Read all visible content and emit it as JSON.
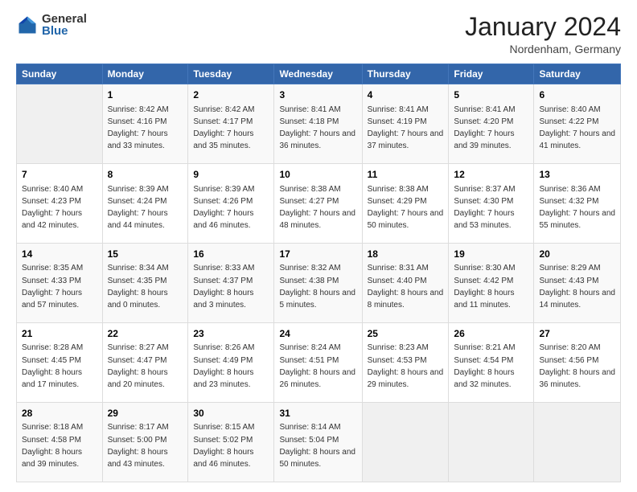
{
  "header": {
    "logo_general": "General",
    "logo_blue": "Blue",
    "month_title": "January 2024",
    "location": "Nordenham, Germany"
  },
  "days_of_week": [
    "Sunday",
    "Monday",
    "Tuesday",
    "Wednesday",
    "Thursday",
    "Friday",
    "Saturday"
  ],
  "weeks": [
    [
      {
        "day": "",
        "sunrise": "",
        "sunset": "",
        "daylight": "",
        "empty": true
      },
      {
        "day": "1",
        "sunrise": "Sunrise: 8:42 AM",
        "sunset": "Sunset: 4:16 PM",
        "daylight": "Daylight: 7 hours and 33 minutes."
      },
      {
        "day": "2",
        "sunrise": "Sunrise: 8:42 AM",
        "sunset": "Sunset: 4:17 PM",
        "daylight": "Daylight: 7 hours and 35 minutes."
      },
      {
        "day": "3",
        "sunrise": "Sunrise: 8:41 AM",
        "sunset": "Sunset: 4:18 PM",
        "daylight": "Daylight: 7 hours and 36 minutes."
      },
      {
        "day": "4",
        "sunrise": "Sunrise: 8:41 AM",
        "sunset": "Sunset: 4:19 PM",
        "daylight": "Daylight: 7 hours and 37 minutes."
      },
      {
        "day": "5",
        "sunrise": "Sunrise: 8:41 AM",
        "sunset": "Sunset: 4:20 PM",
        "daylight": "Daylight: 7 hours and 39 minutes."
      },
      {
        "day": "6",
        "sunrise": "Sunrise: 8:40 AM",
        "sunset": "Sunset: 4:22 PM",
        "daylight": "Daylight: 7 hours and 41 minutes."
      }
    ],
    [
      {
        "day": "7",
        "sunrise": "Sunrise: 8:40 AM",
        "sunset": "Sunset: 4:23 PM",
        "daylight": "Daylight: 7 hours and 42 minutes."
      },
      {
        "day": "8",
        "sunrise": "Sunrise: 8:39 AM",
        "sunset": "Sunset: 4:24 PM",
        "daylight": "Daylight: 7 hours and 44 minutes."
      },
      {
        "day": "9",
        "sunrise": "Sunrise: 8:39 AM",
        "sunset": "Sunset: 4:26 PM",
        "daylight": "Daylight: 7 hours and 46 minutes."
      },
      {
        "day": "10",
        "sunrise": "Sunrise: 8:38 AM",
        "sunset": "Sunset: 4:27 PM",
        "daylight": "Daylight: 7 hours and 48 minutes."
      },
      {
        "day": "11",
        "sunrise": "Sunrise: 8:38 AM",
        "sunset": "Sunset: 4:29 PM",
        "daylight": "Daylight: 7 hours and 50 minutes."
      },
      {
        "day": "12",
        "sunrise": "Sunrise: 8:37 AM",
        "sunset": "Sunset: 4:30 PM",
        "daylight": "Daylight: 7 hours and 53 minutes."
      },
      {
        "day": "13",
        "sunrise": "Sunrise: 8:36 AM",
        "sunset": "Sunset: 4:32 PM",
        "daylight": "Daylight: 7 hours and 55 minutes."
      }
    ],
    [
      {
        "day": "14",
        "sunrise": "Sunrise: 8:35 AM",
        "sunset": "Sunset: 4:33 PM",
        "daylight": "Daylight: 7 hours and 57 minutes."
      },
      {
        "day": "15",
        "sunrise": "Sunrise: 8:34 AM",
        "sunset": "Sunset: 4:35 PM",
        "daylight": "Daylight: 8 hours and 0 minutes."
      },
      {
        "day": "16",
        "sunrise": "Sunrise: 8:33 AM",
        "sunset": "Sunset: 4:37 PM",
        "daylight": "Daylight: 8 hours and 3 minutes."
      },
      {
        "day": "17",
        "sunrise": "Sunrise: 8:32 AM",
        "sunset": "Sunset: 4:38 PM",
        "daylight": "Daylight: 8 hours and 5 minutes."
      },
      {
        "day": "18",
        "sunrise": "Sunrise: 8:31 AM",
        "sunset": "Sunset: 4:40 PM",
        "daylight": "Daylight: 8 hours and 8 minutes."
      },
      {
        "day": "19",
        "sunrise": "Sunrise: 8:30 AM",
        "sunset": "Sunset: 4:42 PM",
        "daylight": "Daylight: 8 hours and 11 minutes."
      },
      {
        "day": "20",
        "sunrise": "Sunrise: 8:29 AM",
        "sunset": "Sunset: 4:43 PM",
        "daylight": "Daylight: 8 hours and 14 minutes."
      }
    ],
    [
      {
        "day": "21",
        "sunrise": "Sunrise: 8:28 AM",
        "sunset": "Sunset: 4:45 PM",
        "daylight": "Daylight: 8 hours and 17 minutes."
      },
      {
        "day": "22",
        "sunrise": "Sunrise: 8:27 AM",
        "sunset": "Sunset: 4:47 PM",
        "daylight": "Daylight: 8 hours and 20 minutes."
      },
      {
        "day": "23",
        "sunrise": "Sunrise: 8:26 AM",
        "sunset": "Sunset: 4:49 PM",
        "daylight": "Daylight: 8 hours and 23 minutes."
      },
      {
        "day": "24",
        "sunrise": "Sunrise: 8:24 AM",
        "sunset": "Sunset: 4:51 PM",
        "daylight": "Daylight: 8 hours and 26 minutes."
      },
      {
        "day": "25",
        "sunrise": "Sunrise: 8:23 AM",
        "sunset": "Sunset: 4:53 PM",
        "daylight": "Daylight: 8 hours and 29 minutes."
      },
      {
        "day": "26",
        "sunrise": "Sunrise: 8:21 AM",
        "sunset": "Sunset: 4:54 PM",
        "daylight": "Daylight: 8 hours and 32 minutes."
      },
      {
        "day": "27",
        "sunrise": "Sunrise: 8:20 AM",
        "sunset": "Sunset: 4:56 PM",
        "daylight": "Daylight: 8 hours and 36 minutes."
      }
    ],
    [
      {
        "day": "28",
        "sunrise": "Sunrise: 8:18 AM",
        "sunset": "Sunset: 4:58 PM",
        "daylight": "Daylight: 8 hours and 39 minutes."
      },
      {
        "day": "29",
        "sunrise": "Sunrise: 8:17 AM",
        "sunset": "Sunset: 5:00 PM",
        "daylight": "Daylight: 8 hours and 43 minutes."
      },
      {
        "day": "30",
        "sunrise": "Sunrise: 8:15 AM",
        "sunset": "Sunset: 5:02 PM",
        "daylight": "Daylight: 8 hours and 46 minutes."
      },
      {
        "day": "31",
        "sunrise": "Sunrise: 8:14 AM",
        "sunset": "Sunset: 5:04 PM",
        "daylight": "Daylight: 8 hours and 50 minutes."
      },
      {
        "day": "",
        "sunrise": "",
        "sunset": "",
        "daylight": "",
        "empty": true
      },
      {
        "day": "",
        "sunrise": "",
        "sunset": "",
        "daylight": "",
        "empty": true
      },
      {
        "day": "",
        "sunrise": "",
        "sunset": "",
        "daylight": "",
        "empty": true
      }
    ]
  ]
}
